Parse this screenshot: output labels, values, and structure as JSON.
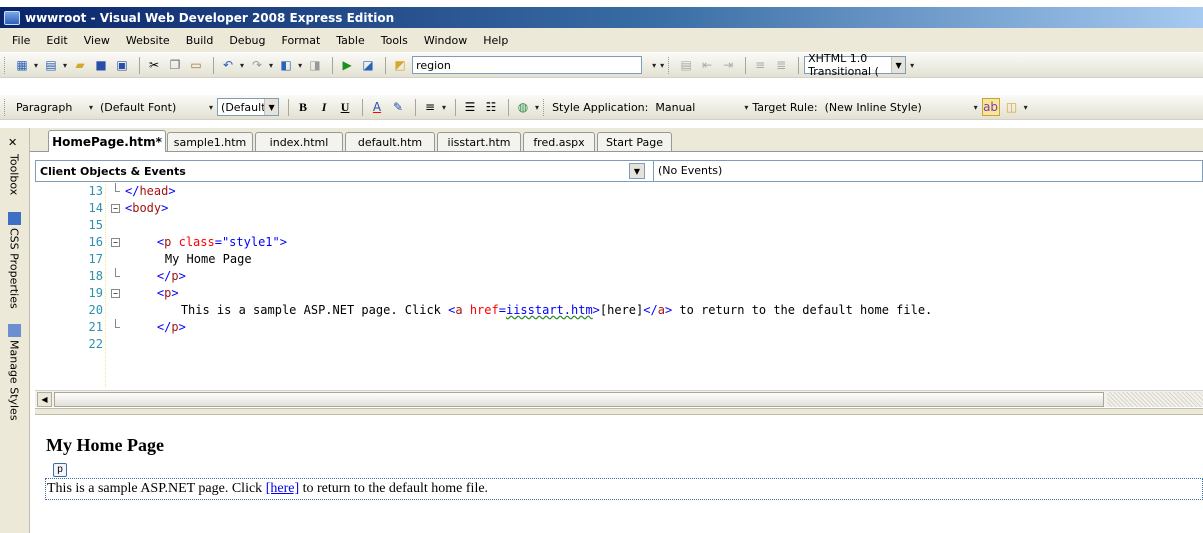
{
  "window": {
    "title": "wwwroot - Visual Web Developer 2008 Express Edition"
  },
  "menu": [
    "File",
    "Edit",
    "View",
    "Website",
    "Build",
    "Debug",
    "Format",
    "Table",
    "Tools",
    "Window",
    "Help"
  ],
  "toolbar1": {
    "find_combo": "region",
    "doctype_combo": "XHTML 1.0 Transitional ("
  },
  "toolbar2": {
    "block_format": "Paragraph",
    "font_name": "(Default Font)",
    "font_size": "(Default",
    "style_application_label": "Style Application:",
    "style_application_value": "Manual",
    "target_rule_label": "Target Rule:",
    "target_rule_value": "(New Inline Style)"
  },
  "tabs": [
    "HomePage.htm*",
    "sample1.htm",
    "index.html",
    "default.htm",
    "iisstart.htm",
    "fred.aspx",
    "Start Page"
  ],
  "side_tabs": [
    "Toolbox",
    "CSS Properties",
    "Manage Styles"
  ],
  "object_bar": {
    "left": "Client Objects & Events",
    "right": "(No Events)"
  },
  "code_lines": [
    {
      "num": "13",
      "seg": [
        [
          "bracket",
          "</"
        ],
        [
          "tag",
          "head"
        ],
        [
          "bracket",
          ">"
        ]
      ],
      "indent": 0
    },
    {
      "num": "14",
      "seg": [
        [
          "bracket",
          "<"
        ],
        [
          "tag",
          "body"
        ],
        [
          "bracket",
          ">"
        ]
      ],
      "indent": 0
    },
    {
      "num": "15",
      "seg": [],
      "indent": 0
    },
    {
      "num": "16",
      "seg": [
        [
          "bracket",
          "<"
        ],
        [
          "tag",
          "p"
        ],
        [
          "plain",
          " "
        ],
        [
          "attr",
          "class"
        ],
        [
          "bracket",
          "="
        ],
        [
          "val",
          "\"style1\""
        ],
        [
          "bracket",
          ">"
        ]
      ],
      "indent": 4
    },
    {
      "num": "17",
      "seg": [
        [
          "plain",
          "My Home Page"
        ]
      ],
      "indent": 5
    },
    {
      "num": "18",
      "seg": [
        [
          "bracket",
          "</"
        ],
        [
          "tag",
          "p"
        ],
        [
          "bracket",
          ">"
        ]
      ],
      "indent": 4
    },
    {
      "num": "19",
      "seg": [
        [
          "bracket",
          "<"
        ],
        [
          "tag",
          "p"
        ],
        [
          "bracket",
          ">"
        ]
      ],
      "indent": 4
    },
    {
      "num": "20",
      "seg": [
        [
          "plain",
          "This is a sample ASP.NET page. Click "
        ],
        [
          "bracket",
          "<"
        ],
        [
          "tag",
          "a"
        ],
        [
          "plain",
          " "
        ],
        [
          "attr",
          "href"
        ],
        [
          "bracket",
          "="
        ],
        [
          "val",
          "iisstart.htm"
        ],
        [
          "bracket",
          ">"
        ],
        [
          "plain",
          "[here]"
        ],
        [
          "bracket",
          "</"
        ],
        [
          "tag",
          "a"
        ],
        [
          "bracket",
          ">"
        ],
        [
          "plain",
          " to return to the default home file."
        ]
      ],
      "indent": 7
    },
    {
      "num": "21",
      "seg": [
        [
          "bracket",
          "</"
        ],
        [
          "tag",
          "p"
        ],
        [
          "bracket",
          ">"
        ]
      ],
      "indent": 4
    },
    {
      "num": "22",
      "seg": [],
      "indent": 0
    }
  ],
  "design": {
    "heading": "My Home Page",
    "p_tag": "p",
    "para_before": "This is a sample ASP.NET page. Click ",
    "link_text": "[here]",
    "para_after": " to return to the default home file."
  }
}
